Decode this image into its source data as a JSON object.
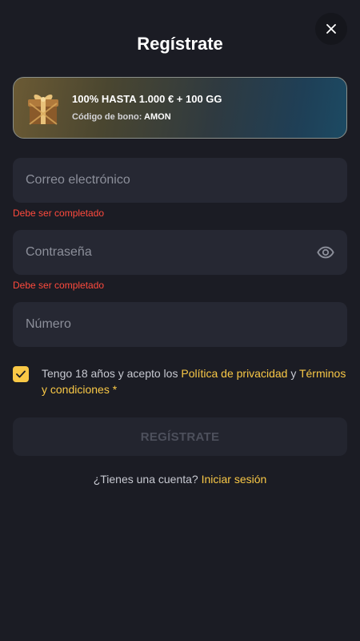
{
  "header": {
    "title": "Regístrate",
    "close_icon": "close-icon"
  },
  "bonus": {
    "title": "100% HASTA 1.000 € + 100 GG",
    "code_label": "Código de bono:",
    "code_value": "AMON",
    "icon": "gift-icon"
  },
  "form": {
    "email": {
      "placeholder": "Correo electrónico",
      "value": "",
      "error": "Debe ser completado"
    },
    "password": {
      "placeholder": "Contraseña",
      "value": "",
      "error": "Debe ser completado",
      "icon": "eye-icon"
    },
    "phone": {
      "placeholder": "Número",
      "value": ""
    }
  },
  "terms": {
    "checked": true,
    "prefix": "Tengo 18 años y acepto los",
    "privacy_link": "Política de privacidad",
    "connector": "y",
    "terms_link": "Términos y condiciones",
    "required_mark": "*"
  },
  "submit": {
    "label": "REGÍSTRATE"
  },
  "login": {
    "prompt": "¿Tienes una cuenta?",
    "link": "Iniciar sesión"
  },
  "colors": {
    "background": "#1b1c24",
    "field": "#262833",
    "accent": "#f9c846",
    "error": "#ff4a3d"
  }
}
